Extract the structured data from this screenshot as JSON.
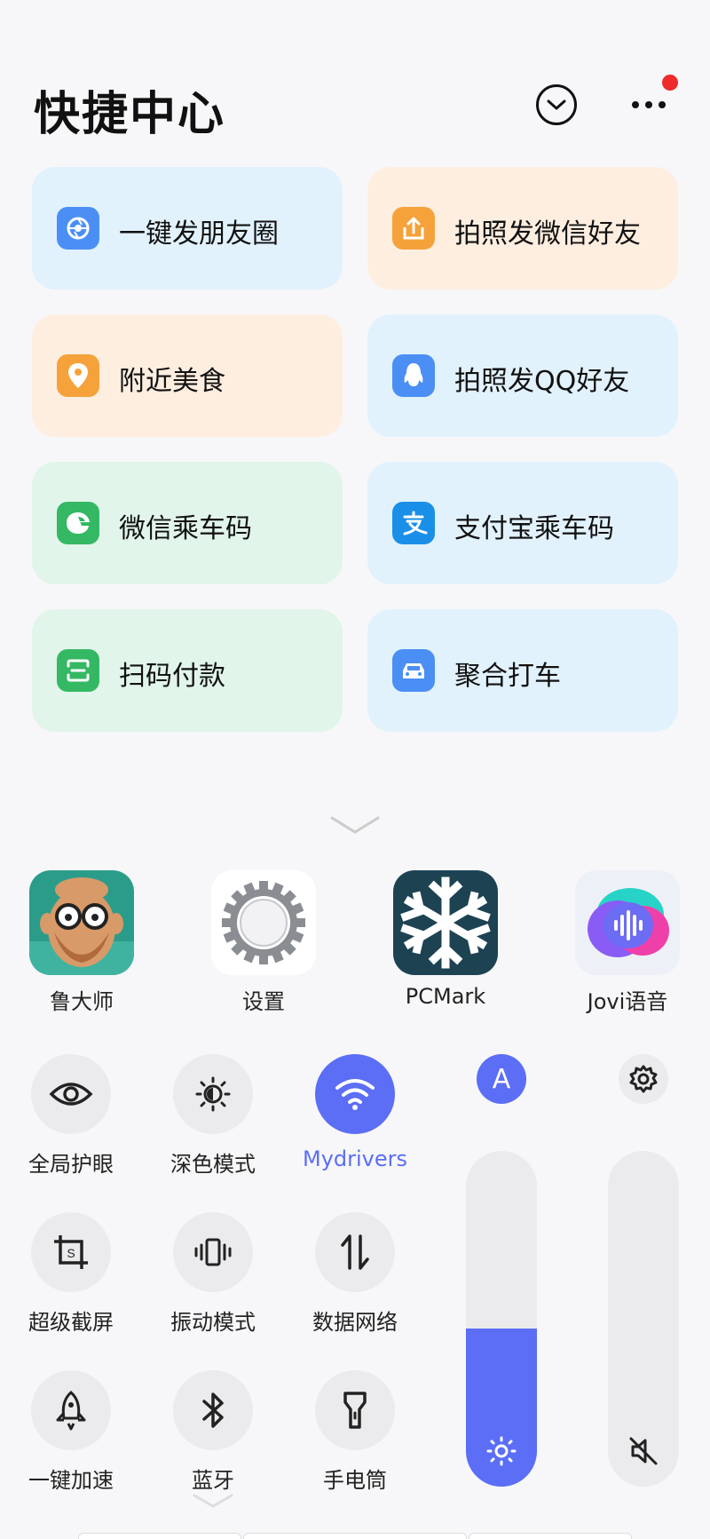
{
  "header": {
    "title": "快捷中心",
    "collapse_icon": "chevron-down-circle-icon",
    "more_icon": "more-dots-icon",
    "notification_dot_color": "#ee2b2b"
  },
  "shortcuts": [
    {
      "label": "一键发朋友圈",
      "icon": "moments-camera-icon",
      "bg": "blue",
      "icon_color": "#4b8ff5"
    },
    {
      "label": "拍照发微信好友",
      "icon": "share-upload-icon",
      "bg": "orange",
      "icon_color": "#f5a23a"
    },
    {
      "label": "附近美食",
      "icon": "location-pin-icon",
      "bg": "orange",
      "icon_color": "#f5a23a"
    },
    {
      "label": "拍照发QQ好友",
      "icon": "qq-penguin-icon",
      "bg": "blue",
      "icon_color": "#4b8ff5"
    },
    {
      "label": "微信乘车码",
      "icon": "wechat-bus-code-icon",
      "bg": "green",
      "icon_color": "#35b864"
    },
    {
      "label": "支付宝乘车码",
      "icon": "alipay-icon",
      "bg": "blue",
      "icon_color": "#1a8fe8"
    },
    {
      "label": "扫码付款",
      "icon": "scan-pay-icon",
      "bg": "green",
      "icon_color": "#35b864"
    },
    {
      "label": "聚合打车",
      "icon": "car-icon",
      "bg": "blue",
      "icon_color": "#4b8ff5"
    }
  ],
  "apps": [
    {
      "label": "鲁大师",
      "icon": "ludashi-app-icon"
    },
    {
      "label": "设置",
      "icon": "settings-gear-app-icon"
    },
    {
      "label": "PCMark",
      "icon": "pcmark-snowflake-app-icon"
    },
    {
      "label": "Jovi语音",
      "icon": "jovi-voice-app-icon"
    }
  ],
  "toggles": [
    {
      "label": "全局护眼",
      "icon": "eye-icon",
      "on": false
    },
    {
      "label": "深色模式",
      "icon": "dark-mode-icon",
      "on": false
    },
    {
      "label": "Mydrivers",
      "icon": "wifi-icon",
      "on": true
    },
    {
      "label": "超级截屏",
      "icon": "screenshot-icon",
      "on": false
    },
    {
      "label": "振动模式",
      "icon": "vibrate-icon",
      "on": false
    },
    {
      "label": "数据网络",
      "icon": "mobile-data-icon",
      "on": false
    },
    {
      "label": "一键加速",
      "icon": "rocket-icon",
      "on": false
    },
    {
      "label": "蓝牙",
      "icon": "bluetooth-icon",
      "on": false
    },
    {
      "label": "手电筒",
      "icon": "flashlight-icon",
      "on": false
    }
  ],
  "brightness": {
    "auto_label": "A",
    "level": 0.47,
    "icon": "brightness-sun-icon"
  },
  "volume": {
    "level": 0.0,
    "icon": "muted-speaker-icon",
    "settings_icon": "gear-icon"
  },
  "colors": {
    "accent": "#5b6ef5"
  }
}
